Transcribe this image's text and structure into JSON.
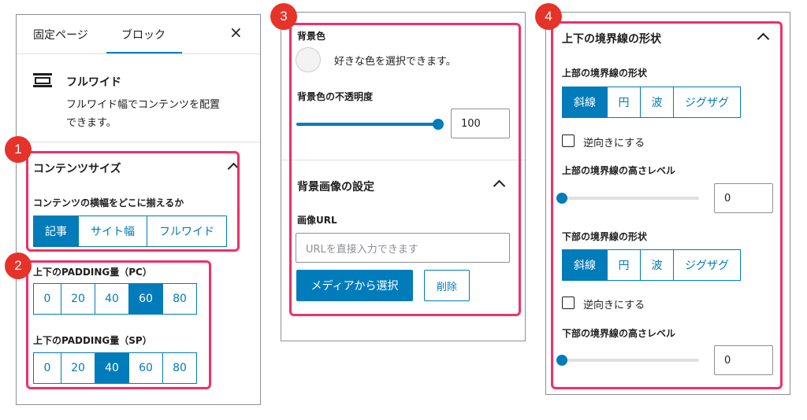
{
  "badges": [
    "1",
    "2",
    "3",
    "4"
  ],
  "panel1": {
    "tabs": [
      "固定ページ",
      "ブロック"
    ],
    "close": "×",
    "block_name": "フルワイド",
    "block_desc_1": "フルワイド幅でコンテンツを配置",
    "block_desc_2": "できます。",
    "content_size": {
      "title": "コンテンツサイズ",
      "label": "コンテンツの横幅をどこに揃えるか",
      "options": [
        "記事",
        "サイト幅",
        "フルワイド"
      ]
    },
    "padding_pc": {
      "label": "上下のPADDING量（PC）",
      "options": [
        "0",
        "20",
        "40",
        "60",
        "80"
      ]
    },
    "padding_sp": {
      "label": "上下のPADDING量（SP）",
      "options": [
        "0",
        "20",
        "40",
        "60",
        "80"
      ]
    }
  },
  "panel3": {
    "bg_color_label": "背景色",
    "bg_color_hint": "好きな色を選択できます。",
    "opacity_label": "背景色の不透明度",
    "opacity_value": "100",
    "opacity_level": 1.0,
    "bg_image_title": "背景画像の設定",
    "image_url_label": "画像URL",
    "image_url_placeholder": "URLを直接入力できます",
    "media_button": "メディアから選択",
    "delete_button": "削除"
  },
  "panel4": {
    "title": "上下の境界線の形状",
    "top_shape_label": "上部の境界線の形状",
    "shape_options": [
      "斜線",
      "円",
      "波",
      "ジグザグ"
    ],
    "reverse_label": "逆向きにする",
    "top_height_label": "上部の境界線の高さレベル",
    "top_height_value": "0",
    "bottom_shape_label": "下部の境界線の形状",
    "bottom_height_label": "下部の境界線の高さレベル",
    "bottom_height_value": "0"
  },
  "colors": {
    "accent": "#007cba",
    "highlight": "#f0306a",
    "badge": "#e5332a"
  }
}
